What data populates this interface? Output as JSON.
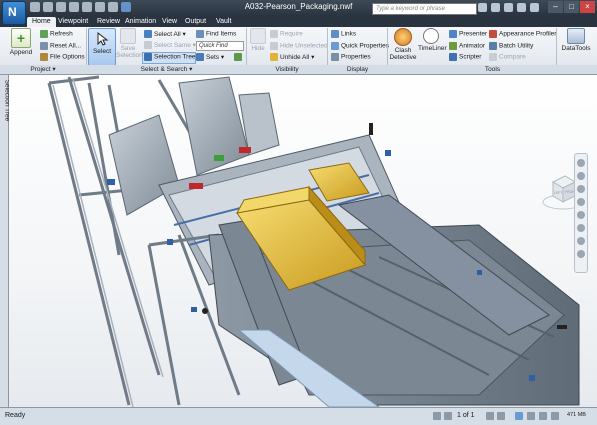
{
  "window": {
    "title": "A032-Pearson_Packaging.nwf",
    "app_letter": "N"
  },
  "search": {
    "placeholder": "Type a keyword or phrase"
  },
  "tabs": [
    {
      "label": "Home",
      "active": true
    },
    {
      "label": "Viewpoint"
    },
    {
      "label": "Review"
    },
    {
      "label": "Animation"
    },
    {
      "label": "View"
    },
    {
      "label": "Output"
    },
    {
      "label": "Vault"
    }
  ],
  "ribbon": {
    "project": {
      "label": "Project",
      "append": "Append",
      "refresh": "Refresh",
      "reset_all": "Reset All...",
      "file_options": "File Options"
    },
    "select_search": {
      "label": "Select & Search",
      "select": "Select",
      "save_selection": "Save Selection",
      "select_all": "Select All",
      "select_same": "Select Same",
      "selection_tree": "Selection Tree",
      "find_items": "Find Items",
      "quick_find": "Quick Find",
      "sets": "Sets"
    },
    "visibility": {
      "label": "Visibility",
      "hide": "Hide",
      "require": "Require",
      "hide_unselected": "Hide Unselected",
      "unhide_all": "Unhide All"
    },
    "display": {
      "label": "Display",
      "links": "Links",
      "quick_properties": "Quick Properties",
      "properties": "Properties"
    },
    "tools": {
      "label": "Tools",
      "clash_detective": "Clash Detective",
      "timeliner": "TimeLiner",
      "presenter": "Presenter",
      "animator": "Animator",
      "scripter": "Scripter",
      "appearance_profiler": "Appearance Profiler",
      "batch_utility": "Batch Utility",
      "compare": "Compare",
      "datatools": "DataTools"
    }
  },
  "side_panel": {
    "label": "Selection Tree"
  },
  "viewcube": {
    "left": "LEFT",
    "front": "FRONT"
  },
  "status": {
    "ready": "Ready",
    "page": "1 of 1",
    "memory": "471 MB"
  },
  "colors": {
    "accent": "#3f8fd8",
    "model_yellow": "#e8c23a",
    "model_steel": "#8e9aa6"
  }
}
